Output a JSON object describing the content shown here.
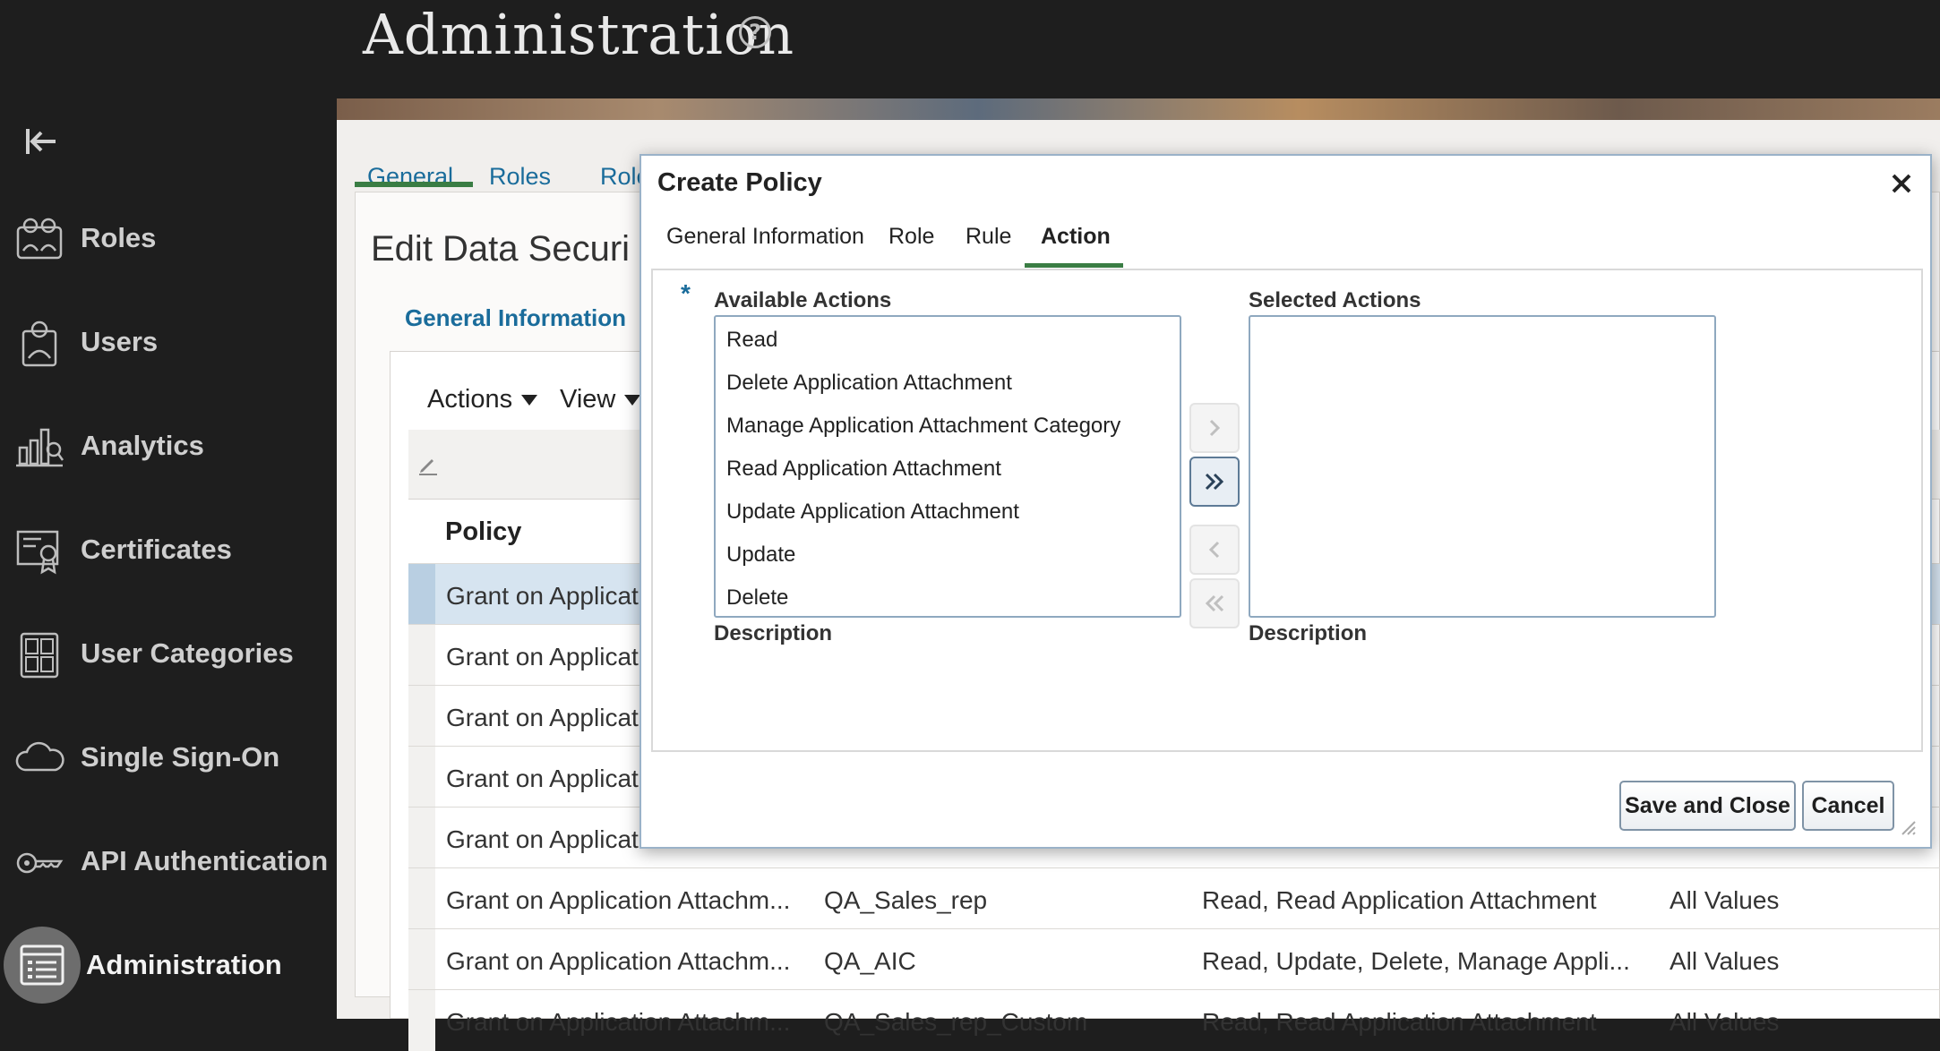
{
  "header": {
    "title": "Administration",
    "help_icon": "help-circle-icon"
  },
  "sidebar": {
    "collapse_icon": "collapse-left-icon",
    "items": [
      {
        "label": "Roles",
        "icon": "roles-icon"
      },
      {
        "label": "Users",
        "icon": "user-icon"
      },
      {
        "label": "Analytics",
        "icon": "analytics-icon"
      },
      {
        "label": "Certificates",
        "icon": "certificate-icon"
      },
      {
        "label": "User Categories",
        "icon": "user-categories-icon"
      },
      {
        "label": "Single Sign-On",
        "icon": "cloud-icon"
      },
      {
        "label": "API Authentication",
        "icon": "key-icon"
      },
      {
        "label": "Administration",
        "icon": "administration-icon"
      }
    ]
  },
  "main": {
    "tabs": [
      {
        "label": "General"
      },
      {
        "label": "Roles"
      },
      {
        "label": "Role C"
      }
    ],
    "edit_title": "Edit Data Securi",
    "subnav": "General Information",
    "toolbar": {
      "actions": "Actions",
      "view": "View"
    },
    "table": {
      "policy_header": "Policy",
      "rows": [
        {
          "policy": "Grant on Applicat",
          "role": "",
          "actions": "",
          "condition": ""
        },
        {
          "policy": "Grant on Applicat",
          "role": "",
          "actions": "",
          "condition": ""
        },
        {
          "policy": "Grant on Applicat",
          "role": "",
          "actions": "",
          "condition": ""
        },
        {
          "policy": "Grant on Applicat",
          "role": "",
          "actions": "",
          "condition": ""
        },
        {
          "policy": "Grant on Applicat",
          "role": "",
          "actions": "",
          "condition": ""
        },
        {
          "policy": "Grant on Application Attachm...",
          "role": "QA_Sales_rep",
          "actions": "Read, Read Application Attachment",
          "condition": "All Values"
        },
        {
          "policy": "Grant on Application Attachm...",
          "role": "QA_AIC",
          "actions": "Read, Update, Delete, Manage Appli...",
          "condition": "All Values"
        },
        {
          "policy": "Grant on Application Attachm...",
          "role": "QA_Sales_rep_Custom",
          "actions": "Read, Read Application Attachment",
          "condition": "All Values"
        }
      ]
    }
  },
  "dialog": {
    "title": "Create Policy",
    "close_icon": "close-icon",
    "tabs": [
      {
        "label": "General Information"
      },
      {
        "label": "Role"
      },
      {
        "label": "Rule"
      },
      {
        "label": "Action"
      }
    ],
    "active_tab": "Action",
    "required_mark": "*",
    "available": {
      "label": "Available Actions",
      "options": [
        "Read",
        "Delete Application Attachment",
        "Manage Application Attachment Category",
        "Read Application Attachment",
        "Update Application Attachment",
        "Update",
        "Delete"
      ],
      "description_label": "Description"
    },
    "selected": {
      "label": "Selected Actions",
      "options": [],
      "description_label": "Description"
    },
    "buttons": {
      "save_close": "Save and Close",
      "cancel": "Cancel"
    }
  },
  "colors": {
    "sidebar_bg": "#1e1e1e",
    "link_blue": "#1a6c9b",
    "active_tab_green": "#3a7d44",
    "selected_row": "#d6e4f0"
  }
}
